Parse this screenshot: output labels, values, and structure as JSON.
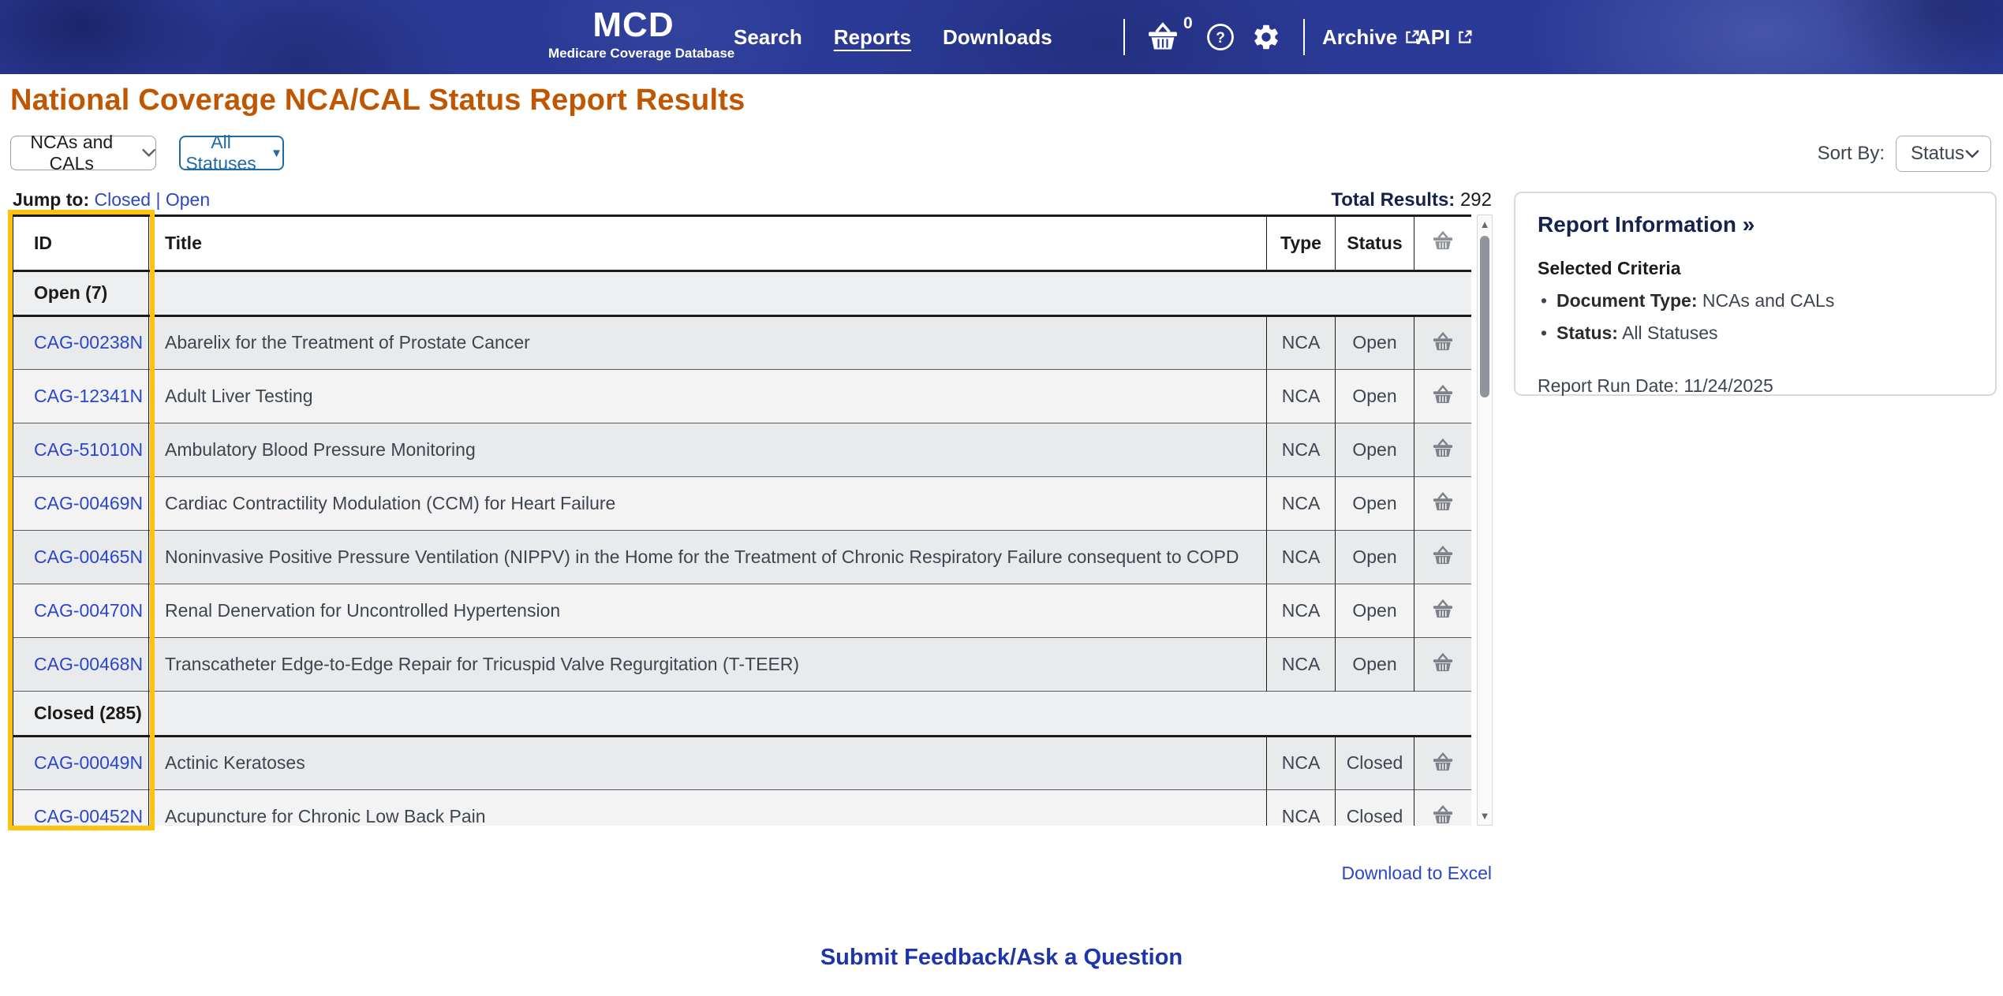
{
  "navbar": {
    "logo_title": "MCD",
    "logo_subtitle": "Medicare Coverage Database",
    "links": [
      {
        "label": "Search",
        "active": false
      },
      {
        "label": "Reports",
        "active": true
      },
      {
        "label": "Downloads",
        "active": false
      }
    ],
    "basket_count": "0",
    "icons": [
      "basket-icon",
      "help-icon",
      "gear-icon"
    ],
    "external_links": [
      {
        "label": "Archive",
        "icon": "external-link-icon"
      },
      {
        "label": "API",
        "icon": "external-link-icon"
      }
    ]
  },
  "page": {
    "title": "National Coverage NCA/CAL Status Report Results",
    "doc_type_filter_label": "NCAs and CALs",
    "status_filter_label": "All Statuses",
    "sort_by_label": "Sort By:",
    "sort_by_value": "Status",
    "jump_to_label": "Jump to:",
    "jump_links": [
      "Closed",
      "Open"
    ],
    "jump_separator": "|",
    "total_results_label": "Total Results:",
    "total_results_value": " 292",
    "download_link_label": "Download to Excel",
    "feedback_link_label": "Submit Feedback/Ask a Question"
  },
  "table": {
    "headers": {
      "id": "ID",
      "title": "Title",
      "type": "Type",
      "status": "Status",
      "basket": "basket-icon"
    },
    "groups": [
      {
        "label": "Open (7)",
        "rows": [
          {
            "id": "CAG-00238N",
            "title": "Abarelix for the Treatment of Prostate Cancer",
            "type": "NCA",
            "status": "Open"
          },
          {
            "id": "CAG-12341N",
            "title": "Adult Liver Testing",
            "type": "NCA",
            "status": "Open"
          },
          {
            "id": "CAG-51010N",
            "title": "Ambulatory Blood Pressure Monitoring",
            "type": "NCA",
            "status": "Open"
          },
          {
            "id": "CAG-00469N",
            "title": "Cardiac Contractility Modulation (CCM) for Heart Failure",
            "type": "NCA",
            "status": "Open"
          },
          {
            "id": "CAG-00465N",
            "title": "Noninvasive Positive Pressure Ventilation (NIPPV) in the Home for the Treatment of Chronic Respiratory Failure consequent to COPD",
            "type": "NCA",
            "status": "Open"
          },
          {
            "id": "CAG-00470N",
            "title": "Renal Denervation for Uncontrolled Hypertension",
            "type": "NCA",
            "status": "Open"
          },
          {
            "id": "CAG-00468N",
            "title": "Transcatheter Edge-to-Edge Repair for Tricuspid Valve Regurgitation (T-TEER)",
            "type": "NCA",
            "status": "Open"
          }
        ]
      },
      {
        "label": "Closed (285)",
        "rows": [
          {
            "id": "CAG-00049N",
            "title": "Actinic Keratoses",
            "type": "NCA",
            "status": "Closed"
          },
          {
            "id": "CAG-00452N",
            "title": "Acupuncture for Chronic Low Back Pain",
            "type": "NCA",
            "status": "Closed"
          }
        ]
      }
    ]
  },
  "report_info": {
    "heading": "Report Information »",
    "criteria_heading": "Selected Criteria",
    "criteria": [
      {
        "label": "Document Type:",
        "value": " NCAs and CALs"
      },
      {
        "label": "Status:",
        "value": " All Statuses"
      }
    ],
    "run_date": "Report Run Date: 11/24/2025"
  },
  "colors": {
    "navbar_blue": "#2b3a96",
    "title_orange": "#c05600",
    "link_blue": "#2b46c8",
    "filter_blue": "#216ba5",
    "focus_gold": "#ffc20e",
    "feedback_blue": "#1e34aa",
    "row_dark": "#e9eaec",
    "row_light": "#f3f3f4"
  }
}
